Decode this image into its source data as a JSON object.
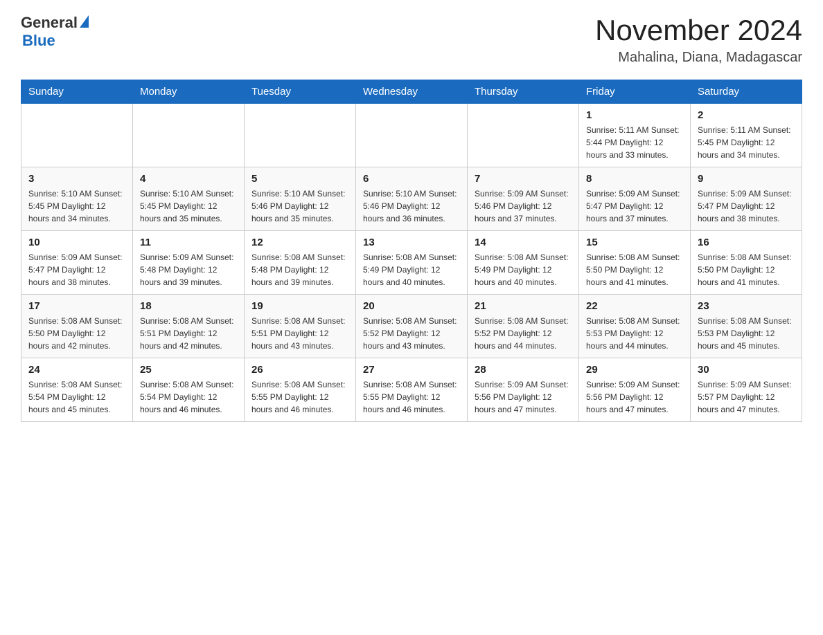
{
  "header": {
    "logo": {
      "general": "General",
      "blue": "Blue"
    },
    "title": "November 2024",
    "subtitle": "Mahalina, Diana, Madagascar"
  },
  "days_of_week": [
    "Sunday",
    "Monday",
    "Tuesday",
    "Wednesday",
    "Thursday",
    "Friday",
    "Saturday"
  ],
  "weeks": [
    {
      "days": [
        {
          "number": "",
          "info": ""
        },
        {
          "number": "",
          "info": ""
        },
        {
          "number": "",
          "info": ""
        },
        {
          "number": "",
          "info": ""
        },
        {
          "number": "",
          "info": ""
        },
        {
          "number": "1",
          "info": "Sunrise: 5:11 AM\nSunset: 5:44 PM\nDaylight: 12 hours and 33 minutes."
        },
        {
          "number": "2",
          "info": "Sunrise: 5:11 AM\nSunset: 5:45 PM\nDaylight: 12 hours and 34 minutes."
        }
      ]
    },
    {
      "days": [
        {
          "number": "3",
          "info": "Sunrise: 5:10 AM\nSunset: 5:45 PM\nDaylight: 12 hours and 34 minutes."
        },
        {
          "number": "4",
          "info": "Sunrise: 5:10 AM\nSunset: 5:45 PM\nDaylight: 12 hours and 35 minutes."
        },
        {
          "number": "5",
          "info": "Sunrise: 5:10 AM\nSunset: 5:46 PM\nDaylight: 12 hours and 35 minutes."
        },
        {
          "number": "6",
          "info": "Sunrise: 5:10 AM\nSunset: 5:46 PM\nDaylight: 12 hours and 36 minutes."
        },
        {
          "number": "7",
          "info": "Sunrise: 5:09 AM\nSunset: 5:46 PM\nDaylight: 12 hours and 37 minutes."
        },
        {
          "number": "8",
          "info": "Sunrise: 5:09 AM\nSunset: 5:47 PM\nDaylight: 12 hours and 37 minutes."
        },
        {
          "number": "9",
          "info": "Sunrise: 5:09 AM\nSunset: 5:47 PM\nDaylight: 12 hours and 38 minutes."
        }
      ]
    },
    {
      "days": [
        {
          "number": "10",
          "info": "Sunrise: 5:09 AM\nSunset: 5:47 PM\nDaylight: 12 hours and 38 minutes."
        },
        {
          "number": "11",
          "info": "Sunrise: 5:09 AM\nSunset: 5:48 PM\nDaylight: 12 hours and 39 minutes."
        },
        {
          "number": "12",
          "info": "Sunrise: 5:08 AM\nSunset: 5:48 PM\nDaylight: 12 hours and 39 minutes."
        },
        {
          "number": "13",
          "info": "Sunrise: 5:08 AM\nSunset: 5:49 PM\nDaylight: 12 hours and 40 minutes."
        },
        {
          "number": "14",
          "info": "Sunrise: 5:08 AM\nSunset: 5:49 PM\nDaylight: 12 hours and 40 minutes."
        },
        {
          "number": "15",
          "info": "Sunrise: 5:08 AM\nSunset: 5:50 PM\nDaylight: 12 hours and 41 minutes."
        },
        {
          "number": "16",
          "info": "Sunrise: 5:08 AM\nSunset: 5:50 PM\nDaylight: 12 hours and 41 minutes."
        }
      ]
    },
    {
      "days": [
        {
          "number": "17",
          "info": "Sunrise: 5:08 AM\nSunset: 5:50 PM\nDaylight: 12 hours and 42 minutes."
        },
        {
          "number": "18",
          "info": "Sunrise: 5:08 AM\nSunset: 5:51 PM\nDaylight: 12 hours and 42 minutes."
        },
        {
          "number": "19",
          "info": "Sunrise: 5:08 AM\nSunset: 5:51 PM\nDaylight: 12 hours and 43 minutes."
        },
        {
          "number": "20",
          "info": "Sunrise: 5:08 AM\nSunset: 5:52 PM\nDaylight: 12 hours and 43 minutes."
        },
        {
          "number": "21",
          "info": "Sunrise: 5:08 AM\nSunset: 5:52 PM\nDaylight: 12 hours and 44 minutes."
        },
        {
          "number": "22",
          "info": "Sunrise: 5:08 AM\nSunset: 5:53 PM\nDaylight: 12 hours and 44 minutes."
        },
        {
          "number": "23",
          "info": "Sunrise: 5:08 AM\nSunset: 5:53 PM\nDaylight: 12 hours and 45 minutes."
        }
      ]
    },
    {
      "days": [
        {
          "number": "24",
          "info": "Sunrise: 5:08 AM\nSunset: 5:54 PM\nDaylight: 12 hours and 45 minutes."
        },
        {
          "number": "25",
          "info": "Sunrise: 5:08 AM\nSunset: 5:54 PM\nDaylight: 12 hours and 46 minutes."
        },
        {
          "number": "26",
          "info": "Sunrise: 5:08 AM\nSunset: 5:55 PM\nDaylight: 12 hours and 46 minutes."
        },
        {
          "number": "27",
          "info": "Sunrise: 5:08 AM\nSunset: 5:55 PM\nDaylight: 12 hours and 46 minutes."
        },
        {
          "number": "28",
          "info": "Sunrise: 5:09 AM\nSunset: 5:56 PM\nDaylight: 12 hours and 47 minutes."
        },
        {
          "number": "29",
          "info": "Sunrise: 5:09 AM\nSunset: 5:56 PM\nDaylight: 12 hours and 47 minutes."
        },
        {
          "number": "30",
          "info": "Sunrise: 5:09 AM\nSunset: 5:57 PM\nDaylight: 12 hours and 47 minutes."
        }
      ]
    }
  ]
}
